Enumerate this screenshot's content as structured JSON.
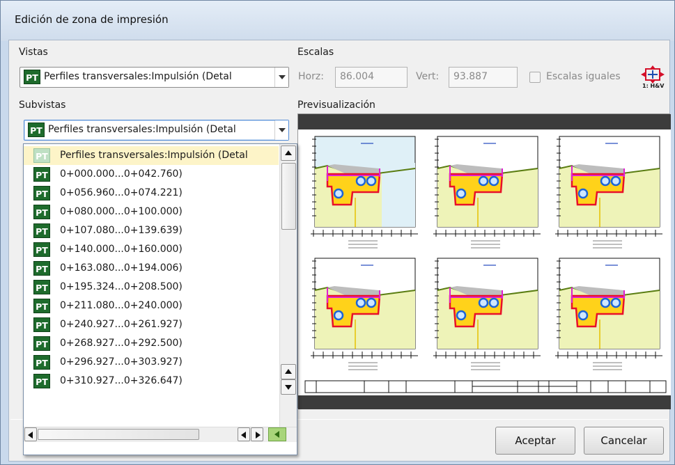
{
  "window": {
    "title": "Edición de zona de impresión"
  },
  "vistas": {
    "label": "Vistas",
    "badge": "PT",
    "value": "Perfiles transversales:Impulsión (Detal"
  },
  "escalas": {
    "label": "Escalas",
    "horz_label": "Horz:",
    "horz_value": "86.004",
    "vert_label": "Vert:",
    "vert_value": "93.887",
    "iguales_label": "Escalas iguales",
    "scale_icon_text": "1: H&V"
  },
  "subvistas": {
    "label": "Subvistas",
    "badge": "PT",
    "value": "Perfiles transversales:Impulsión (Detal",
    "items": [
      "Perfiles transversales:Impulsión (Detal",
      "0+000.000...0+042.760)",
      "0+056.960...0+074.221)",
      "0+080.000...0+100.000)",
      "0+107.080...0+139.639)",
      "0+140.000...0+160.000)",
      "0+163.080...0+194.006)",
      "0+195.324...0+208.500)",
      "0+211.080...0+240.000)",
      "0+240.927...0+261.927)",
      "0+268.927...0+292.500)",
      "0+296.927...0+303.927)",
      "0+310.927...0+326.647)"
    ]
  },
  "preview": {
    "label": "Previsualización"
  },
  "buttons": {
    "accept": "Aceptar",
    "cancel": "Cancelar"
  },
  "colors": {
    "badge_green": "#1e6b2c",
    "selection": "#fdf4c8",
    "terrain_fill": "#eef3b8",
    "water_fill": "#dff0f7",
    "trench_red": "#e8102a",
    "concrete_yellow": "#ffd21a",
    "pipe_blue": "#1c64d6",
    "ground_line": "#5a7d12"
  }
}
